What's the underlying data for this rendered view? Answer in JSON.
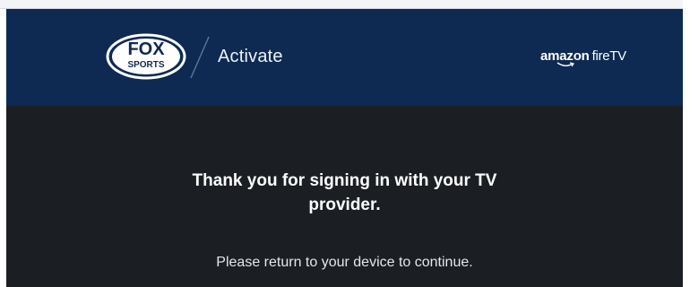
{
  "header": {
    "brand_logo": {
      "icon": "fox-sports-logo",
      "text_top": "FOX",
      "text_bottom": "SPORTS"
    },
    "title": "Activate",
    "partner_logo": {
      "icon": "amazon-fire-tv-logo",
      "amazon_text": "amazon",
      "fire_text": "fireTV"
    }
  },
  "main": {
    "heading": "Thank you for signing in with your TV provider.",
    "message": "Please return to your device to continue."
  },
  "colors": {
    "header_background": "#0e2a52",
    "main_background": "#1b1f24",
    "text_primary": "#ffffff",
    "text_secondary": "#e4e7eb"
  }
}
